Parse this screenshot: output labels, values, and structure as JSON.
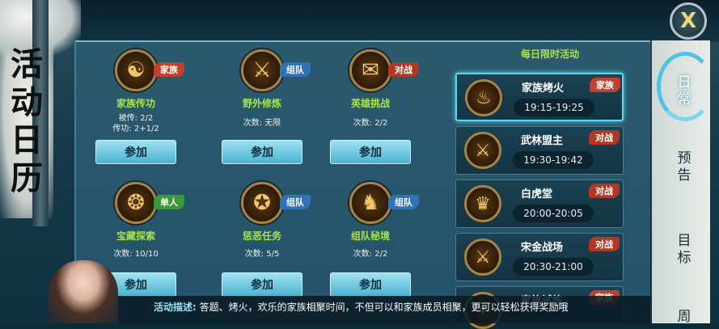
{
  "window": {
    "title_chars": [
      "活",
      "动",
      "日",
      "历"
    ]
  },
  "close_label": "X",
  "activities": [
    {
      "name": "家族传功",
      "tag": "家族",
      "tag_type": "jz",
      "icon": "family-transmit-icon",
      "line1": "被传: 2/2",
      "line2": "传功: 2+1/2",
      "button": "参加"
    },
    {
      "name": "野外修炼",
      "tag": "组队",
      "tag_type": "zd",
      "icon": "crossed-swords-icon",
      "line1": "次数: 无限",
      "line2": "",
      "button": "参加"
    },
    {
      "name": "英雄挑战",
      "tag": "对战",
      "tag_type": "dz",
      "icon": "scroll-icon",
      "line1": "次数: 2/2",
      "line2": "",
      "button": "参加"
    },
    {
      "name": "宝藏探索",
      "tag": "单人",
      "tag_type": "dr",
      "icon": "treasure-icon",
      "line1": "次数: 10/10",
      "line2": "",
      "button": "参加"
    },
    {
      "name": "惩恶任务",
      "tag": "组队",
      "tag_type": "zd",
      "icon": "punish-evil-icon",
      "line1": "次数: 5/5",
      "line2": "",
      "button": "参加"
    },
    {
      "name": "组队秘境",
      "tag": "组队",
      "tag_type": "zd",
      "icon": "dragon-icon",
      "line1": "次数: 2/2",
      "line2": "",
      "button": "参加"
    }
  ],
  "daily": {
    "heading": "每日限时活动",
    "items": [
      {
        "name": "家族烤火",
        "time": "19:15-19:25",
        "tag": "家族",
        "tag_type": "jz",
        "icon": "bonfire-icon"
      },
      {
        "name": "武林盟主",
        "time": "19:30-19:42",
        "tag": "对战",
        "tag_type": "dz",
        "icon": "crossed-swords-icon"
      },
      {
        "name": "白虎堂",
        "time": "20:00-20:05",
        "tag": "对战",
        "tag_type": "dz",
        "icon": "white-tiger-icon"
      },
      {
        "name": "宋金战场",
        "time": "20:30-21:00",
        "tag": "对战",
        "tag_type": "dz",
        "icon": "battlefield-icon"
      },
      {
        "name": "家族试炼",
        "time": "",
        "tag": "家族",
        "tag_type": "jz",
        "icon": "trial-icon"
      }
    ]
  },
  "tabs": [
    {
      "label": "日常",
      "active": true
    },
    {
      "label": "预告",
      "active": false
    },
    {
      "label": "目标",
      "active": false
    },
    {
      "label": "周",
      "active": false
    }
  ],
  "description": {
    "label": "活动描述:",
    "text": "答题、烤火，欢乐的家族相聚时间，不但可以和家族成员相聚，更可以轻松获得奖励哦"
  }
}
